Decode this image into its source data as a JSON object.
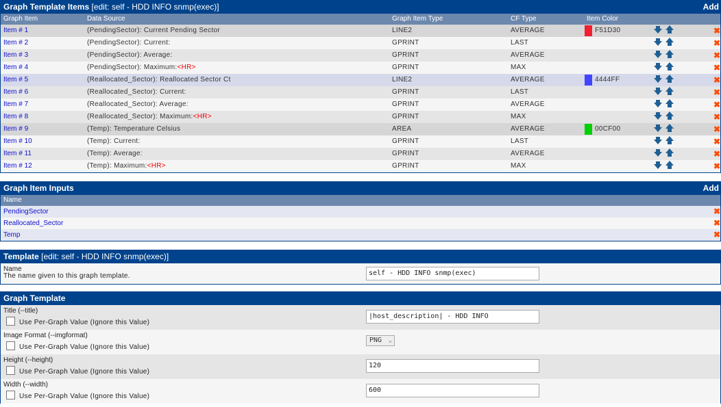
{
  "graph_items_panel": {
    "title": "Graph Template Items",
    "subtitle": "[edit: self - HDD INFO snmp(exec)]",
    "add_label": "Add",
    "columns": [
      "Graph Item",
      "Data Source",
      "Graph Item Type",
      "CF Type",
      "Item Color"
    ],
    "rows": [
      {
        "item": "Item # 1",
        "ds": "(PendingSector): Current Pending Sector",
        "hr": "",
        "type": "LINE2",
        "cf": "AVERAGE",
        "color": "F51D30",
        "swatch": "#F51D30",
        "style": "hl-red"
      },
      {
        "item": "Item # 2",
        "ds": "(PendingSector): Current:",
        "hr": "",
        "type": "GPRINT",
        "cf": "LAST",
        "color": "",
        "swatch": "",
        "style": "even"
      },
      {
        "item": "Item # 3",
        "ds": "(PendingSector): Average:",
        "hr": "",
        "type": "GPRINT",
        "cf": "AVERAGE",
        "color": "",
        "swatch": "",
        "style": "odd"
      },
      {
        "item": "Item # 4",
        "ds": "(PendingSector): Maximum:",
        "hr": "<HR>",
        "type": "GPRINT",
        "cf": "MAX",
        "color": "",
        "swatch": "",
        "style": "even"
      },
      {
        "item": "Item # 5",
        "ds": "(Reallocated_Sector): Reallocated Sector Ct",
        "hr": "",
        "type": "LINE2",
        "cf": "AVERAGE",
        "color": "4444FF",
        "swatch": "#4444FF",
        "style": "hl-blue"
      },
      {
        "item": "Item # 6",
        "ds": "(Reallocated_Sector): Current:",
        "hr": "",
        "type": "GPRINT",
        "cf": "LAST",
        "color": "",
        "swatch": "",
        "style": "odd"
      },
      {
        "item": "Item # 7",
        "ds": "(Reallocated_Sector): Average:",
        "hr": "",
        "type": "GPRINT",
        "cf": "AVERAGE",
        "color": "",
        "swatch": "",
        "style": "even"
      },
      {
        "item": "Item # 8",
        "ds": "(Reallocated_Sector): Maximum:",
        "hr": "<HR>",
        "type": "GPRINT",
        "cf": "MAX",
        "color": "",
        "swatch": "",
        "style": "odd"
      },
      {
        "item": "Item # 9",
        "ds": "(Temp): Temperature Celsius",
        "hr": "",
        "type": "AREA",
        "cf": "AVERAGE",
        "color": "00CF00",
        "swatch": "#00CF00",
        "style": "hl-green"
      },
      {
        "item": "Item # 10",
        "ds": "(Temp): Current:",
        "hr": "",
        "type": "GPRINT",
        "cf": "LAST",
        "color": "",
        "swatch": "",
        "style": "even"
      },
      {
        "item": "Item # 11",
        "ds": "(Temp): Average:",
        "hr": "",
        "type": "GPRINT",
        "cf": "AVERAGE",
        "color": "",
        "swatch": "",
        "style": "odd"
      },
      {
        "item": "Item # 12",
        "ds": "(Temp): Maximum:",
        "hr": "<HR>",
        "type": "GPRINT",
        "cf": "MAX",
        "color": "",
        "swatch": "",
        "style": "even"
      }
    ]
  },
  "graph_item_inputs_panel": {
    "title": "Graph Item Inputs",
    "add_label": "Add",
    "column": "Name",
    "rows": [
      "PendingSector",
      "Reallocated_Sector",
      "Temp"
    ]
  },
  "template_panel": {
    "title": "Template",
    "subtitle": "[edit: self - HDD INFO snmp(exec)]",
    "name_label": "Name",
    "name_desc": "The name given to this graph template.",
    "name_value": "self - HDD INFO snmp(exec)"
  },
  "graph_template_panel": {
    "title": "Graph Template",
    "checkbox_label": "Use Per-Graph Value (Ignore this Value)",
    "fields": [
      {
        "label": "Title (--title)",
        "value": "|host_description| - HDD INFO",
        "kind": "text"
      },
      {
        "label": "Image Format (--imgformat)",
        "value": "PNG",
        "kind": "select"
      },
      {
        "label": "Height (--height)",
        "value": "120",
        "kind": "text"
      },
      {
        "label": "Width (--width)",
        "value": "600",
        "kind": "text"
      }
    ]
  },
  "colors": {
    "header_bg": "#00438c",
    "column_header_bg": "#6d88ad",
    "link": "#1010d0",
    "delete_icon": "#ff4a00",
    "arrow_icon": "#1f5f94"
  }
}
